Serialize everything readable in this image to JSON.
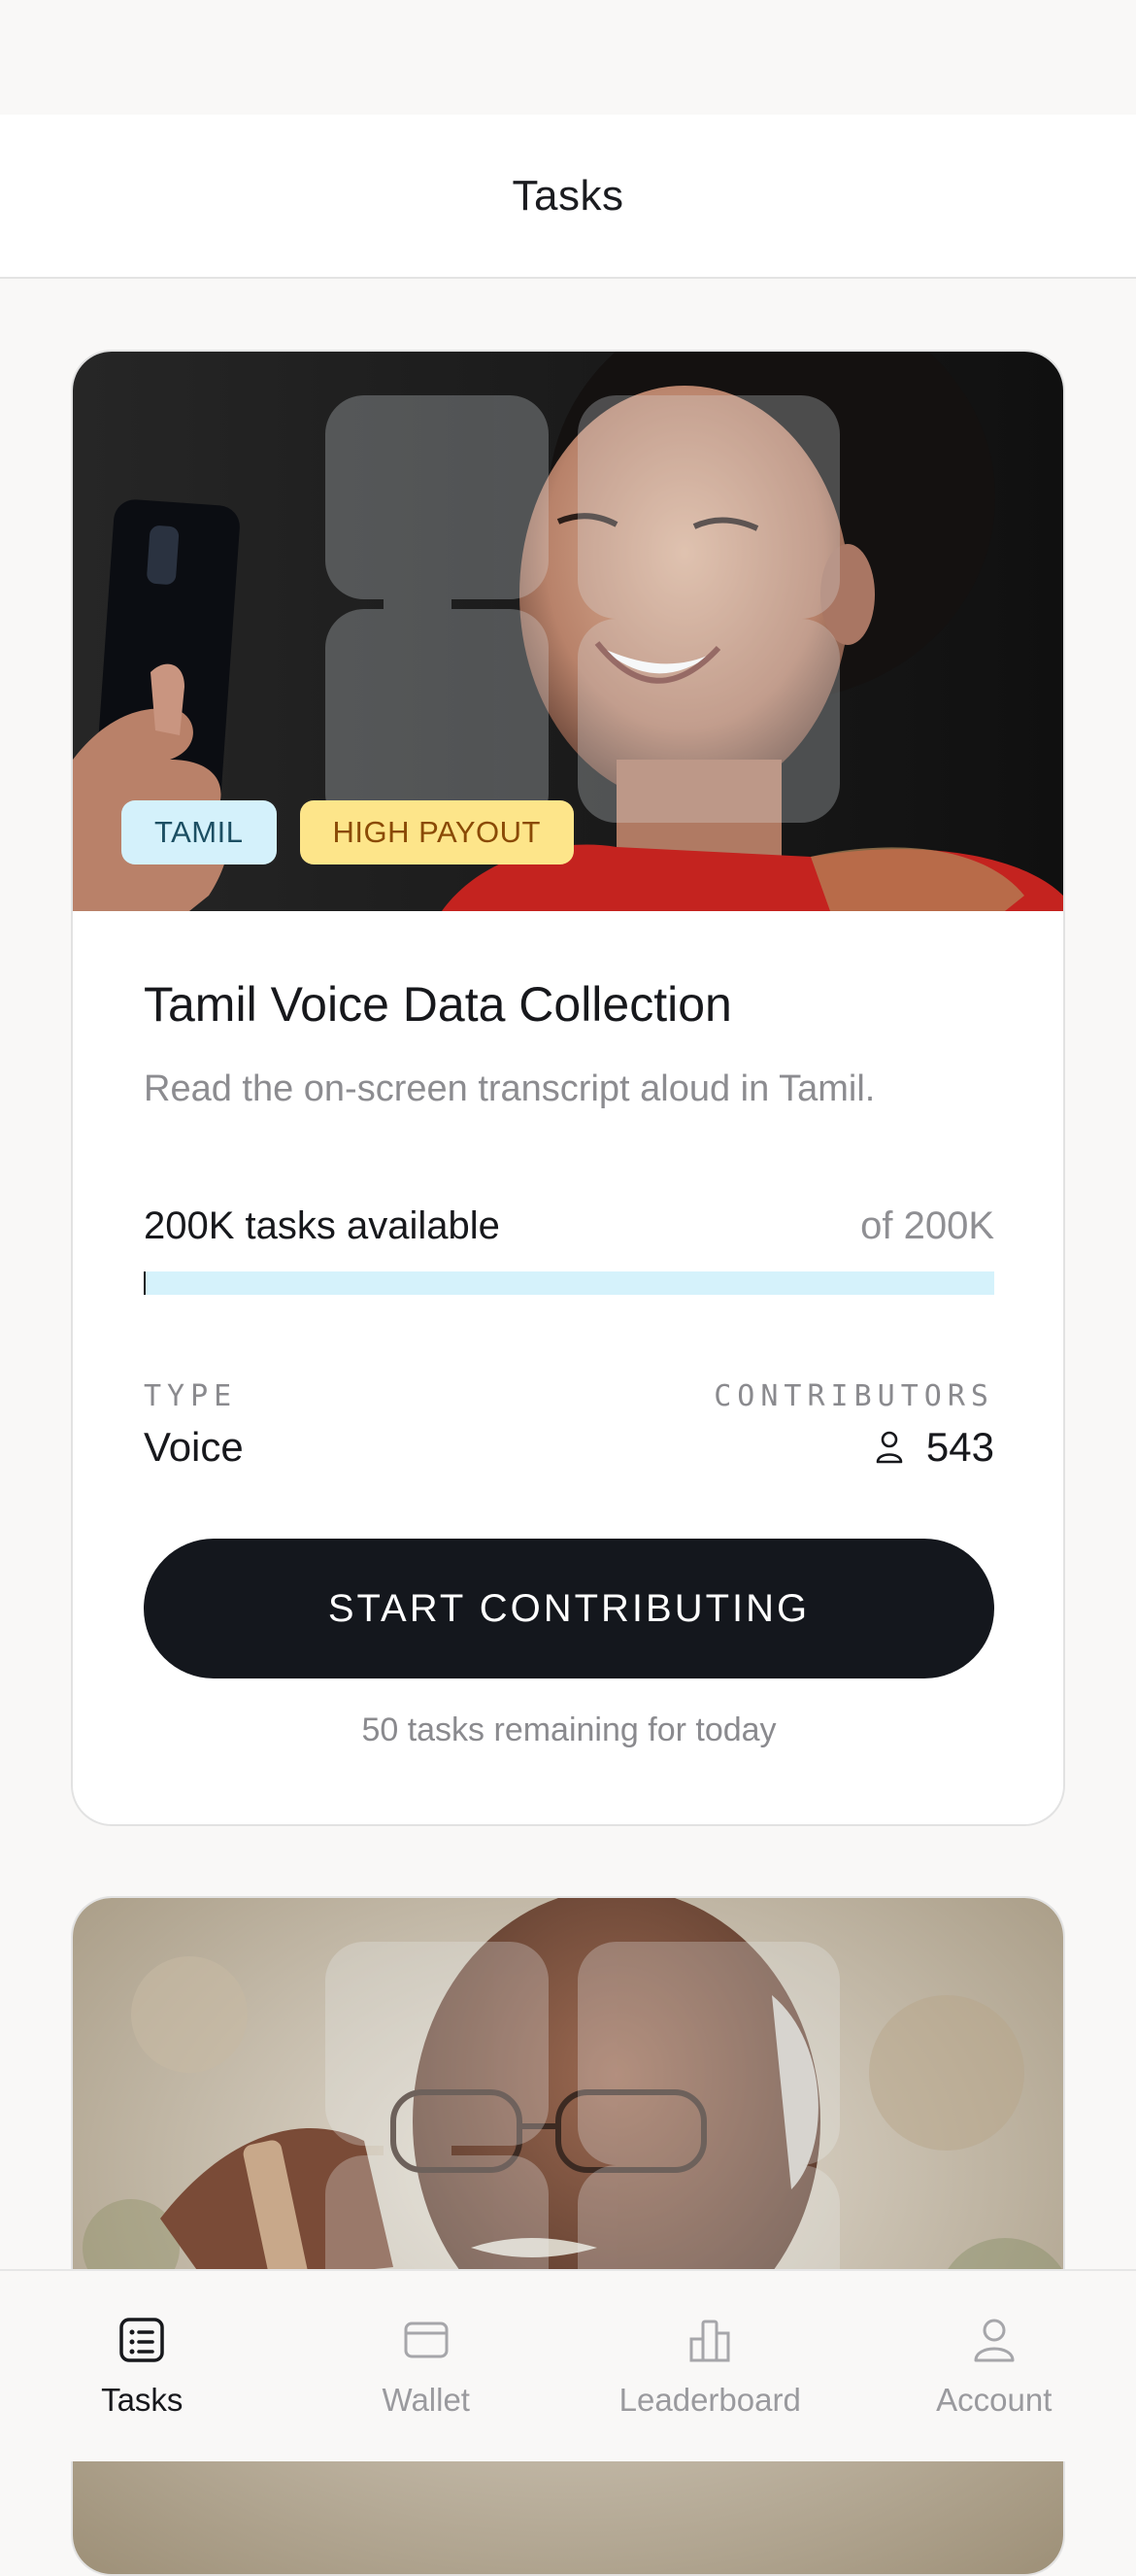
{
  "header": {
    "title": "Tasks"
  },
  "cards": [
    {
      "badges": [
        "TAMIL",
        "HIGH PAYOUT"
      ],
      "title": "Tamil Voice Data Collection",
      "description": "Read the on-screen transcript aloud in Tamil.",
      "availability": "200K tasks available",
      "total": "of 200K",
      "progress": 0,
      "type_label": "TYPE",
      "type_value": "Voice",
      "contributors_label": "CONTRIBUTORS",
      "contributors_value": "543",
      "cta_label": "START CONTRIBUTING",
      "remaining": "50 tasks remaining for today"
    }
  ],
  "tabs": [
    {
      "label": "Tasks",
      "icon": "tasks-list-icon",
      "active": true
    },
    {
      "label": "Wallet",
      "icon": "wallet-icon",
      "active": false
    },
    {
      "label": "Leaderboard",
      "icon": "leaderboard-icon",
      "active": false
    },
    {
      "label": "Account",
      "icon": "account-icon",
      "active": false
    }
  ],
  "colors": {
    "background": "#f9f8f7",
    "cta": "#14171d",
    "badge_language": "#d4f1fb",
    "badge_payout": "#fde58a",
    "progress_track": "#d5f2fb"
  }
}
